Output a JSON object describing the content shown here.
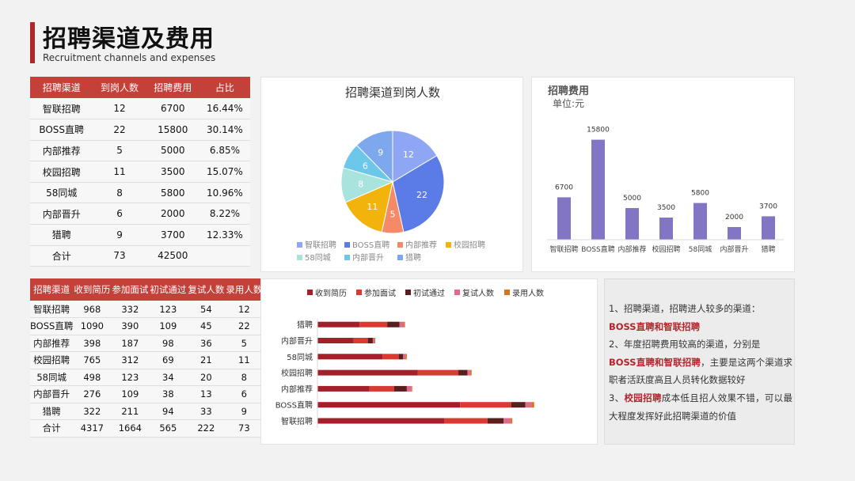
{
  "header": {
    "title": "招聘渠道及费用",
    "subtitle": "Recruitment channels and expenses"
  },
  "table1": {
    "headers": [
      "招聘渠道",
      "到岗人数",
      "招聘费用",
      "占比"
    ],
    "rows": [
      [
        "智联招聘",
        "12",
        "6700",
        "16.44%"
      ],
      [
        "BOSS直聘",
        "22",
        "15800",
        "30.14%"
      ],
      [
        "内部推荐",
        "5",
        "5000",
        "6.85%"
      ],
      [
        "校园招聘",
        "11",
        "3500",
        "15.07%"
      ],
      [
        "58同城",
        "8",
        "5800",
        "10.96%"
      ],
      [
        "内部晋升",
        "6",
        "2000",
        "8.22%"
      ],
      [
        "猎聘",
        "9",
        "3700",
        "12.33%"
      ],
      [
        "合计",
        "73",
        "42500",
        ""
      ]
    ]
  },
  "table2": {
    "headers": [
      "招聘渠道",
      "收到简历",
      "参加面试",
      "初试通过",
      "复试人数",
      "录用人数"
    ],
    "rows": [
      [
        "智联招聘",
        "968",
        "332",
        "123",
        "54",
        "12"
      ],
      [
        "BOSS直聘",
        "1090",
        "390",
        "109",
        "45",
        "22"
      ],
      [
        "内部推荐",
        "398",
        "187",
        "98",
        "36",
        "5"
      ],
      [
        "校园招聘",
        "765",
        "312",
        "69",
        "21",
        "11"
      ],
      [
        "58同城",
        "498",
        "123",
        "34",
        "20",
        "8"
      ],
      [
        "内部晋升",
        "276",
        "109",
        "38",
        "13",
        "6"
      ],
      [
        "猎聘",
        "322",
        "211",
        "94",
        "33",
        "9"
      ],
      [
        "合计",
        "4317",
        "1664",
        "565",
        "222",
        "73"
      ]
    ]
  },
  "chart_data": [
    {
      "type": "pie",
      "title": "招聘渠道到岗人数",
      "categories": [
        "智联招聘",
        "BOSS直聘",
        "内部推荐",
        "校园招聘",
        "58同城",
        "内部晋升",
        "猎聘"
      ],
      "values": [
        12,
        22,
        5,
        11,
        8,
        6,
        9
      ],
      "colors": [
        "#8fa6f5",
        "#5b7be6",
        "#f58a68",
        "#f2b40c",
        "#a9e3dd",
        "#6cc7ea",
        "#7da8ee"
      ],
      "legend": "bottom"
    },
    {
      "type": "bar",
      "title": "招聘费用",
      "subtitle": "单位:元",
      "categories": [
        "智联招聘",
        "BOSS直聘",
        "内部推荐",
        "校园招聘",
        "58同城",
        "内部晋升",
        "猎聘"
      ],
      "values": [
        6700,
        15800,
        5000,
        3500,
        5800,
        2000,
        3700
      ],
      "color": "#8276c4",
      "ylim": [
        0,
        16000
      ],
      "grid": false
    },
    {
      "type": "bar",
      "orientation": "horizontal",
      "stacked": true,
      "categories": [
        "智联招聘",
        "BOSS直聘",
        "内部推荐",
        "校园招聘",
        "58同城",
        "内部晋升",
        "猎聘"
      ],
      "series": [
        {
          "name": "收到简历",
          "values": [
            968,
            1090,
            398,
            765,
            498,
            276,
            322
          ],
          "color": "#a31f2a"
        },
        {
          "name": "参加面试",
          "values": [
            332,
            390,
            187,
            312,
            123,
            109,
            211
          ],
          "color": "#d93a32"
        },
        {
          "name": "初试通过",
          "values": [
            123,
            109,
            98,
            69,
            34,
            38,
            94
          ],
          "color": "#5a1e1e"
        },
        {
          "name": "复试人数",
          "values": [
            54,
            45,
            36,
            21,
            20,
            13,
            33
          ],
          "color": "#e06a8a"
        },
        {
          "name": "录用人数",
          "values": [
            12,
            22,
            5,
            11,
            8,
            6,
            9
          ],
          "color": "#d8741a"
        }
      ],
      "legend": "top",
      "grid": false
    }
  ],
  "summary": {
    "p1": "1、招聘渠道，招聘进人较多的渠道：",
    "p1_highlight": "BOSS直聘和智联招聘",
    "p2": "2、年度招聘费用较高的渠道，分别是",
    "p2_highlight": "BOSS直聘和智联招聘",
    "p2_rest": "，主要是这两个渠道求职者活跃度高且人员转化数据较好",
    "p3": "3、",
    "p3_highlight": "校园招聘",
    "p3_rest": "成本低且招人效果不错，可以最大程度发挥好此招聘渠道的价值"
  }
}
